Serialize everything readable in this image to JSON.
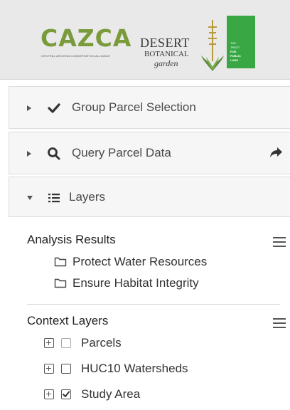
{
  "header": {
    "cazca": {
      "name": "CAZCA",
      "tagline": "CENTRAL ARIZONA CONSERVATION ALLIANCE"
    },
    "dbg": {
      "line1": "DESERT",
      "line2": "BOTANICAL",
      "line3": "garden"
    },
    "tpl": {
      "lines": [
        "THE",
        "TRUST",
        "FOR",
        "PUBLIC",
        "LAND"
      ]
    }
  },
  "panels": [
    {
      "label": "Group Parcel Selection",
      "icon": "check-icon",
      "expanded": false
    },
    {
      "label": "Query Parcel Data",
      "icon": "search-icon",
      "expanded": false,
      "action_icon": "share-icon"
    },
    {
      "label": "Layers",
      "icon": "list-icon",
      "expanded": true
    }
  ],
  "layers": {
    "analysis": {
      "title": "Analysis Results",
      "items": [
        "Protect Water Resources",
        "Ensure Habitat Integrity"
      ]
    },
    "context": {
      "title": "Context Layers",
      "items": [
        {
          "label": "Parcels",
          "checked": false,
          "disabled": true
        },
        {
          "label": "HUC10 Watersheds",
          "checked": false,
          "disabled": false
        },
        {
          "label": "Study Area",
          "checked": true,
          "disabled": false
        }
      ]
    }
  },
  "colors": {
    "cazca_green": "#7a9b3b",
    "tpl_green": "#39a844",
    "header_bg": "#e9e9e9"
  }
}
